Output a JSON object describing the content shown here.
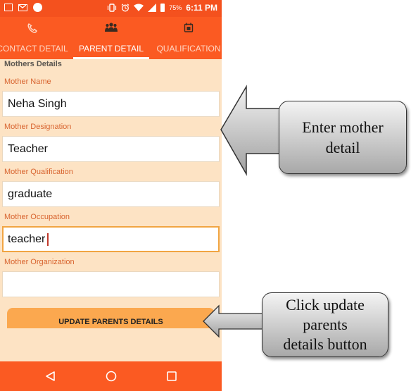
{
  "status_bar": {
    "left_icons": [
      "photo-icon",
      "gmail-icon",
      "circle-notification-icon"
    ],
    "right_icons": [
      "vibrate-icon",
      "alarm-icon",
      "wifi-icon",
      "signal-icon",
      "battery-icon"
    ],
    "battery": "75%",
    "time": "6:11 PM"
  },
  "tabs": [
    {
      "icon": "phone-icon",
      "label": "CONTACT DETAIL",
      "active": false
    },
    {
      "icon": "group-icon",
      "label": "PARENT DETAIL",
      "active": true
    },
    {
      "icon": "calendar-icon",
      "label": "QUALIFICATION",
      "active": false
    }
  ],
  "section_title": "Mothers Details",
  "fields": [
    {
      "label": "Mother Name",
      "value": "Neha Singh",
      "placeholder": ""
    },
    {
      "label": "Mother Designation",
      "value": "Teacher",
      "placeholder": ""
    },
    {
      "label": "Mother Qualification",
      "value": "graduate",
      "placeholder": ""
    },
    {
      "label": "Mother Occupation",
      "value": "teacher",
      "placeholder": "",
      "focused": true
    },
    {
      "label": "Mother Organization",
      "value": "",
      "placeholder": ""
    }
  ],
  "update_button": "UPDATE PARENTS DETAILS",
  "nav": [
    "back-icon",
    "home-icon",
    "recents-icon"
  ],
  "callouts": [
    {
      "text_line1": "Enter mother",
      "text_line2": "detail"
    },
    {
      "text_line1": "Click update",
      "text_line2": "parents",
      "text_line3": "details button"
    }
  ],
  "colors": {
    "primary": "#fb5a22",
    "background": "#fde3c4",
    "label": "#d8642f",
    "button": "#fba84f",
    "focus_border": "#f1a542"
  }
}
